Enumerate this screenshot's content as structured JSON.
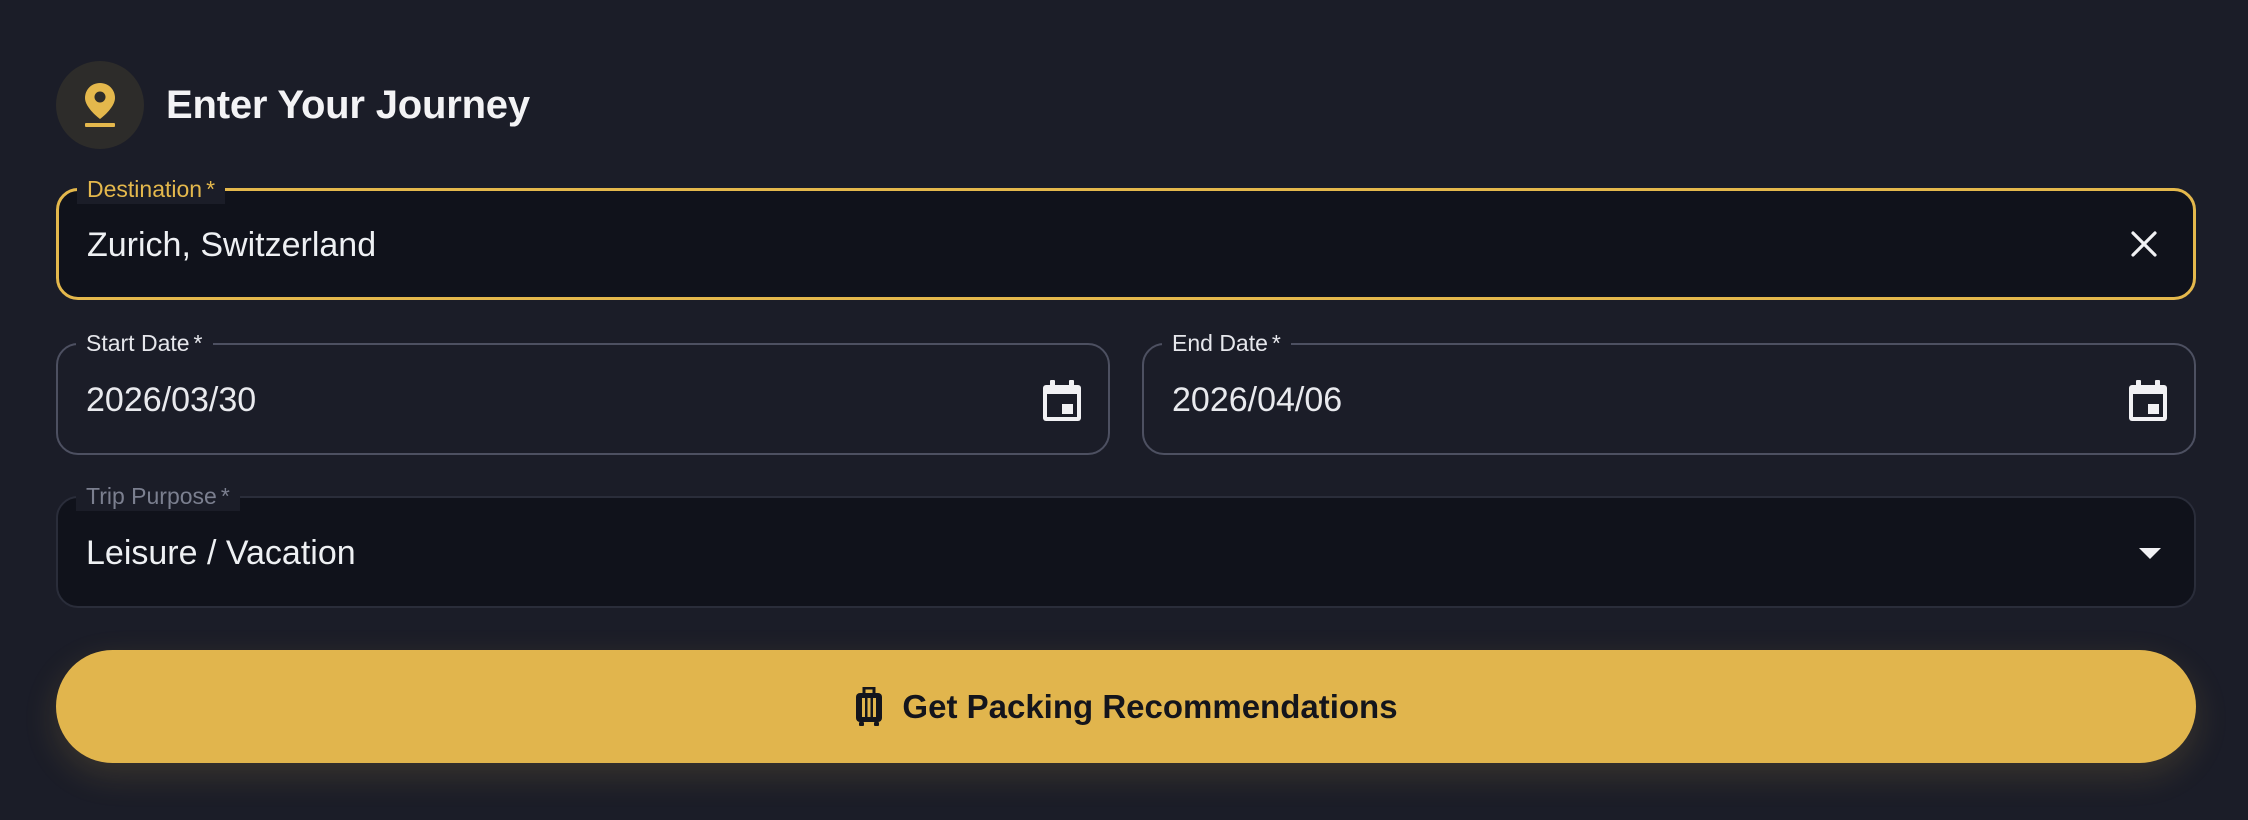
{
  "header": {
    "icon": "location-pin-icon",
    "title": "Enter Your Journey"
  },
  "destination": {
    "label": "Destination",
    "required_marker": "*",
    "value": "Zurich, Switzerland",
    "clear_icon": "close-icon"
  },
  "start_date": {
    "label": "Start Date",
    "required_marker": "*",
    "value": "2026/03/30",
    "icon": "calendar-icon"
  },
  "end_date": {
    "label": "End Date",
    "required_marker": "*",
    "value": "2026/04/06",
    "icon": "calendar-icon"
  },
  "trip_purpose": {
    "label": "Trip Purpose",
    "required_marker": "*",
    "value": "Leisure / Vacation",
    "icon": "dropdown-arrow-icon"
  },
  "cta": {
    "label": "Get Packing Recommendations",
    "icon": "luggage-icon"
  },
  "colors": {
    "background": "#1b1d28",
    "accent": "#e4b84c",
    "field_fill": "#10121b",
    "text": "#f1f1f4",
    "muted_label": "#7b7f8f"
  }
}
